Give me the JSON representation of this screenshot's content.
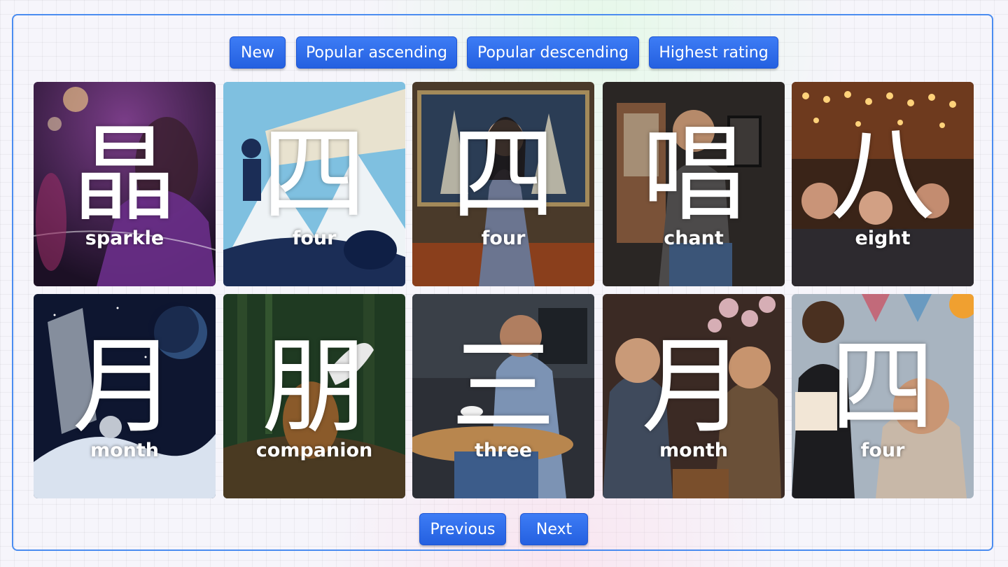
{
  "sort_buttons": [
    {
      "label": "New"
    },
    {
      "label": "Popular ascending"
    },
    {
      "label": "Popular descending"
    },
    {
      "label": "Highest rating"
    }
  ],
  "cards": [
    {
      "kanji": "晶",
      "meaning": "sparkle",
      "scene": "glamorous-party"
    },
    {
      "kanji": "四",
      "meaning": "four",
      "scene": "illustrated-mountain-climber"
    },
    {
      "kanji": "四",
      "meaning": "four",
      "scene": "woman-with-sailboat-painting"
    },
    {
      "kanji": "唱",
      "meaning": "chant",
      "scene": "man-performing-in-room"
    },
    {
      "kanji": "八",
      "meaning": "eight",
      "scene": "crowded-festival"
    },
    {
      "kanji": "月",
      "meaning": "month",
      "scene": "astronaut-in-space"
    },
    {
      "kanji": "朋",
      "meaning": "companion",
      "scene": "dog-in-forest"
    },
    {
      "kanji": "三",
      "meaning": "three",
      "scene": "tired-man-in-cafe"
    },
    {
      "kanji": "月",
      "meaning": "month",
      "scene": "men-under-cherry-blossoms"
    },
    {
      "kanji": "四",
      "meaning": "four",
      "scene": "birthday-cake-celebration"
    }
  ],
  "pagination": {
    "previous_label": "Previous",
    "next_label": "Next"
  },
  "colors": {
    "accent": "#2f6ff0",
    "frame_border": "#4a8cf0"
  }
}
